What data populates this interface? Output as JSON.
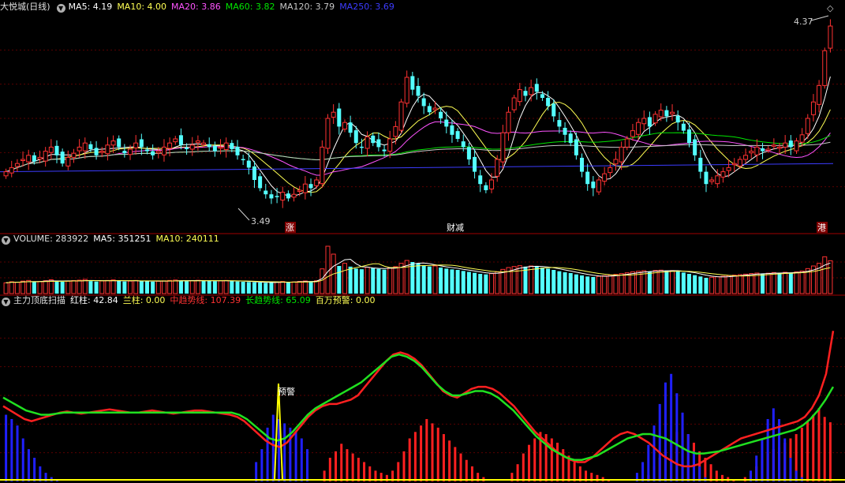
{
  "price_header": {
    "title": "大悦城(日线)",
    "ma5": "MA5: 4.19",
    "ma10": "MA10: 4.00",
    "ma20": "MA20: 3.86",
    "ma60": "MA60: 3.82",
    "ma120": "MA120: 3.79",
    "ma250": "MA250: 3.69"
  },
  "volume_header": {
    "volume": "VOLUME: 283922",
    "ma5": "MA5: 351251",
    "ma10": "MA10: 240111"
  },
  "indicator_header": {
    "title": "主力顶底扫描",
    "red": "红柱: 42.84",
    "blue": "兰柱: 0.00",
    "mid": "中趋势线: 107.39",
    "long": "长趋势线: 65.09",
    "warn": "百万预警: 0.00"
  },
  "annotations": {
    "high": "4.37",
    "low": "3.49",
    "zhang": "涨",
    "caijian": "财减",
    "gang": "港",
    "yujing": "预警"
  },
  "colors": {
    "up": "#ff3232",
    "down": "#54ffff",
    "ma5": "#ffffff",
    "ma10": "#ffff54",
    "ma20": "#ff54ff",
    "ma60": "#00e600",
    "ma120": "#c8c8c8",
    "ma250": "#3c3cff",
    "grid": "#5a0000"
  },
  "chart_data": {
    "type": "candlestick",
    "price_range": [
      3.49,
      4.37
    ],
    "closes": [
      3.66,
      3.68,
      3.7,
      3.72,
      3.74,
      3.71,
      3.73,
      3.76,
      3.78,
      3.74,
      3.7,
      3.73,
      3.75,
      3.78,
      3.8,
      3.77,
      3.74,
      3.76,
      3.79,
      3.81,
      3.78,
      3.75,
      3.77,
      3.8,
      3.78,
      3.76,
      3.74,
      3.76,
      3.78,
      3.8,
      3.82,
      3.79,
      3.77,
      3.79,
      3.81,
      3.8,
      3.78,
      3.76,
      3.78,
      3.8,
      3.77,
      3.74,
      3.72,
      3.68,
      3.62,
      3.58,
      3.55,
      3.53,
      3.54,
      3.56,
      3.53,
      3.55,
      3.57,
      3.6,
      3.58,
      3.62,
      3.78,
      3.92,
      3.95,
      3.88,
      3.9,
      3.85,
      3.8,
      3.78,
      3.83,
      3.8,
      3.78,
      3.76,
      3.82,
      3.88,
      4.0,
      4.12,
      4.06,
      4.03,
      3.98,
      3.95,
      3.97,
      3.92,
      3.88,
      3.84,
      3.82,
      3.78,
      3.72,
      3.66,
      3.6,
      3.57,
      3.62,
      3.72,
      3.85,
      3.95,
      4.02,
      4.06,
      4.03,
      4.07,
      4.05,
      4.02,
      3.98,
      3.93,
      3.88,
      3.84,
      3.8,
      3.74,
      3.66,
      3.6,
      3.58,
      3.62,
      3.65,
      3.68,
      3.72,
      3.78,
      3.82,
      3.86,
      3.9,
      3.92,
      3.88,
      3.94,
      3.96,
      3.93,
      3.95,
      3.9,
      3.86,
      3.8,
      3.74,
      3.66,
      3.6,
      3.62,
      3.64,
      3.66,
      3.68,
      3.7,
      3.72,
      3.74,
      3.76,
      3.78,
      3.76,
      3.77,
      3.79,
      3.78,
      3.8,
      3.78,
      3.81,
      3.84,
      3.92,
      4.0,
      4.08,
      4.25,
      4.37
    ],
    "volume": [
      82,
      90,
      86,
      95,
      100,
      88,
      92,
      98,
      105,
      96,
      90,
      94,
      99,
      102,
      108,
      95,
      92,
      96,
      100,
      104,
      97,
      92,
      95,
      100,
      97,
      94,
      91,
      94,
      97,
      100,
      103,
      98,
      95,
      98,
      101,
      99,
      96,
      94,
      97,
      100,
      96,
      92,
      90,
      88,
      86,
      84,
      82,
      85,
      88,
      92,
      86,
      89,
      93,
      96,
      94,
      98,
      188,
      360,
      300,
      210,
      230,
      205,
      190,
      185,
      200,
      196,
      188,
      182,
      196,
      205,
      230,
      252,
      240,
      228,
      212,
      206,
      210,
      198,
      190,
      184,
      180,
      172,
      165,
      158,
      150,
      146,
      152,
      165,
      184,
      198,
      206,
      212,
      205,
      210,
      205,
      198,
      190,
      180,
      170,
      162,
      156,
      146,
      138,
      130,
      126,
      131,
      136,
      140,
      146,
      152,
      158,
      165,
      170,
      174,
      168,
      176,
      178,
      172,
      175,
      168,
      160,
      150,
      140,
      130,
      120,
      124,
      128,
      132,
      136,
      140,
      144,
      148,
      152,
      156,
      152,
      155,
      160,
      158,
      162,
      158,
      165,
      172,
      190,
      210,
      230,
      280,
      250
    ],
    "indicator": {
      "red": [
        0,
        0,
        0,
        0,
        0,
        0,
        0,
        0,
        0,
        0,
        0,
        0,
        0,
        0,
        0,
        0,
        0,
        0,
        0,
        0,
        0,
        0,
        0,
        0,
        0,
        0,
        0,
        0,
        0,
        0,
        0,
        0,
        0,
        0,
        0,
        0,
        0,
        0,
        0,
        0,
        0,
        0,
        0,
        0,
        0,
        0,
        0,
        0,
        0,
        0,
        0,
        0,
        0,
        0,
        0,
        0,
        10,
        22,
        28,
        35,
        30,
        26,
        22,
        18,
        14,
        10,
        8,
        6,
        10,
        18,
        28,
        40,
        46,
        52,
        58,
        54,
        50,
        44,
        38,
        32,
        26,
        20,
        14,
        8,
        4,
        0,
        0,
        0,
        0,
        8,
        16,
        26,
        34,
        40,
        46,
        44,
        40,
        36,
        30,
        24,
        18,
        14,
        10,
        8,
        6,
        4,
        2,
        0,
        0,
        0,
        0,
        0,
        0,
        6,
        14,
        22,
        30,
        38,
        46,
        50,
        44,
        36,
        28,
        22,
        16,
        10,
        6,
        4,
        2,
        0,
        4,
        8,
        14,
        20,
        26,
        30,
        32,
        36,
        40,
        44,
        50,
        56,
        62,
        68,
        60,
        55
      ],
      "blue": [
        62,
        58,
        52,
        40,
        30,
        22,
        14,
        8,
        4,
        2,
        0,
        0,
        0,
        0,
        0,
        0,
        0,
        0,
        0,
        0,
        0,
        0,
        0,
        0,
        0,
        0,
        0,
        0,
        0,
        0,
        0,
        0,
        0,
        0,
        0,
        0,
        0,
        0,
        0,
        0,
        0,
        0,
        0,
        0,
        18,
        30,
        50,
        62,
        58,
        54,
        50,
        46,
        40,
        30,
        0,
        0,
        0,
        0,
        0,
        0,
        0,
        0,
        0,
        0,
        0,
        0,
        0,
        0,
        0,
        0,
        0,
        0,
        0,
        0,
        0,
        0,
        0,
        0,
        0,
        0,
        0,
        0,
        0,
        0,
        0,
        0,
        0,
        0,
        0,
        0,
        0,
        0,
        0,
        0,
        0,
        0,
        0,
        0,
        0,
        0,
        0,
        0,
        0,
        0,
        0,
        0,
        0,
        0,
        0,
        0,
        0,
        8,
        18,
        34,
        52,
        72,
        92,
        100,
        82,
        64,
        44,
        28,
        14,
        4,
        0,
        0,
        0,
        0,
        0,
        0,
        0,
        10,
        24,
        40,
        58,
        68,
        58,
        40,
        22,
        10,
        4,
        0,
        0,
        0,
        0,
        0,
        0,
        0,
        0,
        0,
        0,
        0,
        0,
        0
      ],
      "mid_trend": [
        70,
        66,
        62,
        58,
        56,
        58,
        60,
        62,
        64,
        65,
        64,
        63,
        64,
        65,
        66,
        67,
        66,
        65,
        64,
        64,
        65,
        66,
        65,
        64,
        63,
        64,
        65,
        66,
        66,
        65,
        64,
        63,
        62,
        60,
        56,
        50,
        44,
        38,
        34,
        32,
        36,
        44,
        52,
        60,
        66,
        70,
        72,
        72,
        74,
        76,
        80,
        88,
        96,
        104,
        112,
        118,
        120,
        118,
        114,
        108,
        100,
        92,
        84,
        80,
        78,
        82,
        86,
        88,
        88,
        86,
        82,
        76,
        70,
        62,
        54,
        46,
        40,
        34,
        28,
        24,
        20,
        18,
        18,
        22,
        28,
        34,
        40,
        44,
        46,
        44,
        40,
        36,
        30,
        24,
        20,
        16,
        14,
        14,
        16,
        20,
        24,
        28,
        32,
        36,
        40,
        42,
        44,
        46,
        48,
        50,
        52,
        54,
        56,
        60,
        68,
        80,
        100,
        140
      ],
      "long_trend": [
        78,
        74,
        70,
        66,
        64,
        62,
        62,
        63,
        64,
        64,
        64,
        64,
        64,
        64,
        64,
        64,
        64,
        64,
        64,
        64,
        64,
        64,
        64,
        64,
        64,
        64,
        64,
        64,
        64,
        64,
        64,
        62,
        58,
        52,
        46,
        40,
        38,
        40,
        46,
        54,
        62,
        68,
        72,
        76,
        80,
        84,
        88,
        92,
        98,
        104,
        110,
        116,
        118,
        116,
        112,
        106,
        98,
        90,
        84,
        80,
        80,
        82,
        84,
        84,
        82,
        78,
        72,
        66,
        58,
        50,
        42,
        36,
        30,
        26,
        22,
        20,
        20,
        22,
        24,
        28,
        32,
        36,
        40,
        42,
        44,
        44,
        42,
        40,
        36,
        32,
        28,
        26,
        26,
        27,
        28,
        30,
        32,
        34,
        36,
        38,
        40,
        42,
        44,
        46,
        48,
        52,
        58,
        66,
        76,
        88
      ]
    },
    "warn_spike": {
      "value": "预警"
    }
  }
}
